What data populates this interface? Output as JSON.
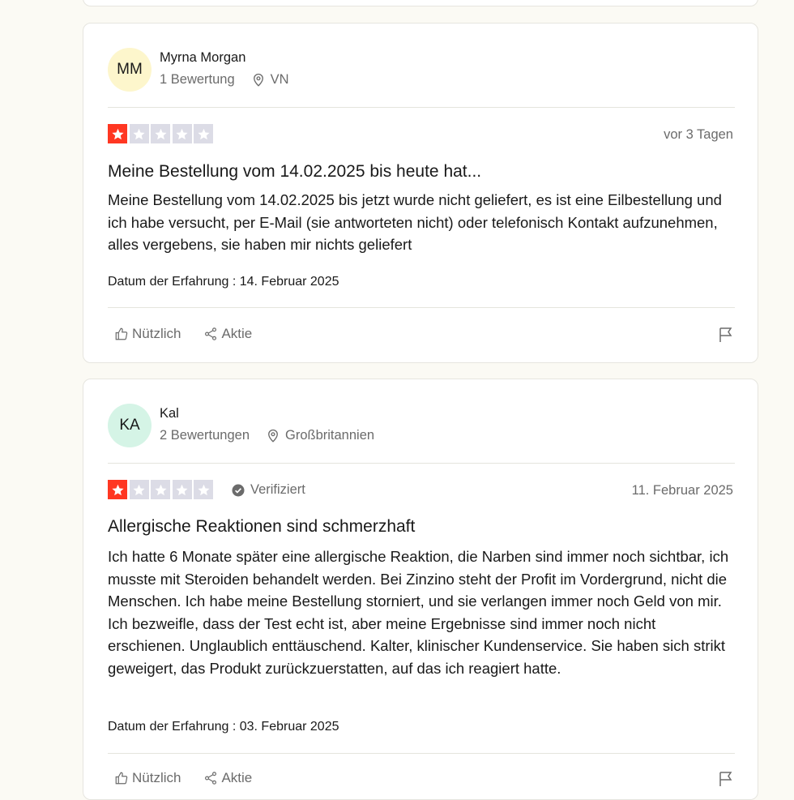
{
  "reviews": [
    {
      "initials": "MM",
      "name": "Myrna Morgan",
      "review_count": "1 Bewertung",
      "location": "VN",
      "rating": 1,
      "verified_label": "",
      "date": "vor 3 Tagen",
      "title": "Meine Bestellung vom 14.02.2025 bis heute hat...",
      "text": "Meine Bestellung vom 14.02.2025 bis jetzt wurde nicht geliefert, es ist eine Eilbestellung und ich habe versucht, per E-Mail (sie antworteten nicht) oder telefonisch Kontakt aufzunehmen, alles vergebens, sie haben mir nichts geliefert",
      "experience_date": "Datum der Erfahrung : 14. Februar 2025",
      "useful_label": "Nützlich",
      "share_label": "Aktie"
    },
    {
      "initials": "KA",
      "name": "Kal",
      "review_count": "2 Bewertungen",
      "location": "Großbritannien",
      "rating": 1,
      "verified_label": "Verifiziert",
      "date": "11. Februar 2025",
      "title": "Allergische Reaktionen sind schmerzhaft",
      "text": "Ich hatte 6 Monate später eine allergische Reaktion, die Narben sind immer noch sichtbar, ich musste mit Steroiden behandelt werden. Bei Zinzino steht der Profit im Vordergrund, nicht die Menschen. Ich habe meine Bestellung storniert, und sie verlangen immer noch Geld von mir. Ich bezweifle, dass der Test echt ist, aber meine Ergebnisse sind immer noch nicht erschienen. Unglaublich enttäuschend. Kalter, klinischer Kundenservice. Sie haben sich strikt geweigert, das Produkt zurückzuerstatten, auf das ich reagiert hatte.",
      "experience_date": "Datum der Erfahrung : 03. Februar 2025",
      "useful_label": "Nützlich",
      "share_label": "Aktie"
    }
  ],
  "colors": {
    "star_active": "#ff3722",
    "star_inactive": "#dcdce6",
    "avatar_1": "#fdf6cc",
    "avatar_2": "#d5f4e6"
  }
}
